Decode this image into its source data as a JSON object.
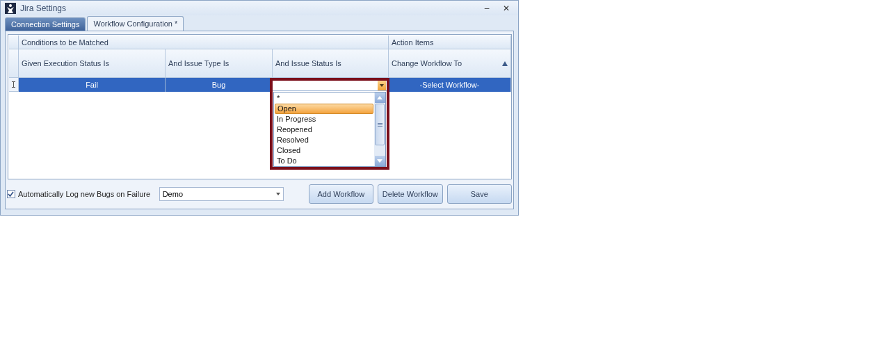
{
  "window": {
    "title": "Jira Settings",
    "buttons": [
      "‒",
      "✕"
    ]
  },
  "tabs": [
    {
      "label": "Connection Settings",
      "selected": false
    },
    {
      "label": "Workflow Configuration *",
      "selected": true
    }
  ],
  "grid": {
    "groups": [
      {
        "label": "Conditions to be Matched"
      },
      {
        "label": "Action Items"
      }
    ],
    "columns": [
      {
        "label": "Given Execution Status Is",
        "sorted": false
      },
      {
        "label": "And Issue Type Is",
        "sorted": false
      },
      {
        "label": "And Issue Status Is",
        "sorted": false
      },
      {
        "label": "Change Workflow To",
        "sorted": true
      }
    ],
    "rows": [
      {
        "selected": true,
        "cells": [
          "Fail",
          "Bug",
          "",
          "-Select Workflow-"
        ]
      }
    ]
  },
  "dropdown": {
    "items": [
      {
        "label": "*",
        "selected": false
      },
      {
        "label": "Open",
        "selected": true
      },
      {
        "label": "In Progress",
        "selected": false
      },
      {
        "label": "Reopened",
        "selected": false
      },
      {
        "label": "Resolved",
        "selected": false
      },
      {
        "label": "Closed",
        "selected": false
      },
      {
        "label": "To Do",
        "selected": false
      }
    ]
  },
  "auto_log": {
    "label": "Automatically Log new Bugs on Failure",
    "checked": true
  },
  "project": {
    "value": "Demo"
  },
  "buttons": [
    "Add Workflow",
    "Delete Workflow",
    "Save"
  ]
}
